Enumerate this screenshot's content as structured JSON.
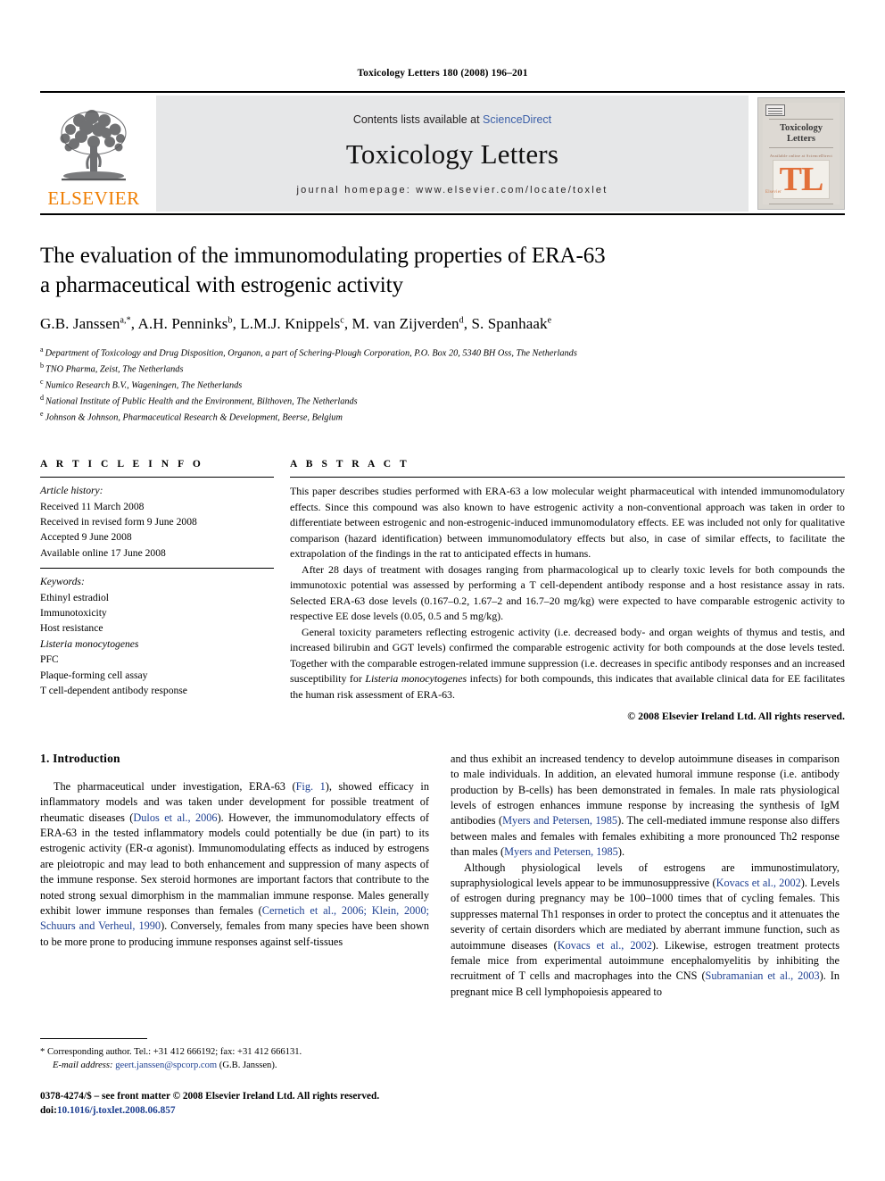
{
  "running_head": "Toxicology Letters 180 (2008) 196–201",
  "masthead": {
    "publisher": "ELSEVIER",
    "contents_prefix": "Contents lists available at ",
    "sciencedirect": "ScienceDirect",
    "journal_title": "Toxicology Letters",
    "homepage": "journal homepage: www.elsevier.com/locate/toxlet",
    "cover": {
      "title_line1": "Toxicology",
      "title_line2": "Letters",
      "subtitle": "Available online at ScienceDirect",
      "logo": "TL",
      "badge": "Elsevier"
    }
  },
  "article": {
    "title_line1": "The evaluation of the immunomodulating properties of ERA-63",
    "title_line2": "a pharmaceutical with estrogenic activity",
    "authors": [
      {
        "name": "G.B. Janssen",
        "sup": "a,*"
      },
      {
        "name": "A.H. Penninks",
        "sup": "b"
      },
      {
        "name": "L.M.J. Knippels",
        "sup": "c"
      },
      {
        "name": "M. van Zijverden",
        "sup": "d"
      },
      {
        "name": "S. Spanhaak",
        "sup": "e"
      }
    ],
    "affiliations": [
      {
        "mark": "a",
        "text": "Department of Toxicology and Drug Disposition, Organon, a part of Schering-Plough Corporation, P.O. Box 20, 5340 BH Oss, The Netherlands"
      },
      {
        "mark": "b",
        "text": "TNO Pharma, Zeist, The Netherlands"
      },
      {
        "mark": "c",
        "text": "Numico Research B.V., Wageningen, The Netherlands"
      },
      {
        "mark": "d",
        "text": "National Institute of Public Health and the Environment, Bilthoven, The Netherlands"
      },
      {
        "mark": "e",
        "text": "Johnson & Johnson, Pharmaceutical Research & Development, Beerse, Belgium"
      }
    ]
  },
  "article_info": {
    "heading": "A R T I C L E   I N F O",
    "history_label": "Article history:",
    "history": [
      "Received 11 March 2008",
      "Received in revised form 9 June 2008",
      "Accepted 9 June 2008",
      "Available online 17 June 2008"
    ],
    "keywords_label": "Keywords:",
    "keywords": [
      {
        "text": "Ethinyl estradiol",
        "italic": false
      },
      {
        "text": "Immunotoxicity",
        "italic": false
      },
      {
        "text": "Host resistance",
        "italic": false
      },
      {
        "text": "Listeria monocytogenes",
        "italic": true
      },
      {
        "text": "PFC",
        "italic": false
      },
      {
        "text": "Plaque-forming cell assay",
        "italic": false
      },
      {
        "text": "T cell-dependent antibody response",
        "italic": false
      }
    ]
  },
  "abstract": {
    "heading": "A B S T R A C T",
    "p1": "This paper describes studies performed with ERA-63 a low molecular weight pharmaceutical with intended immunomodulatory effects. Since this compound was also known to have estrogenic activity a non-conventional approach was taken in order to differentiate between estrogenic and non-estrogenic-induced immunomodulatory effects. EE was included not only for qualitative comparison (hazard identification) between immunomodulatory effects but also, in case of similar effects, to facilitate the extrapolation of the findings in the rat to anticipated effects in humans.",
    "p2": "After 28 days of treatment with dosages ranging from pharmacological up to clearly toxic levels for both compounds the immunotoxic potential was assessed by performing a T cell-dependent antibody response and a host resistance assay in rats. Selected ERA-63 dose levels (0.167–0.2, 1.67–2 and 16.7–20 mg/kg) were expected to have comparable estrogenic activity to respective EE dose levels (0.05, 0.5 and 5 mg/kg).",
    "p3_a": "General toxicity parameters reflecting estrogenic activity (i.e. decreased body- and organ weights of thymus and testis, and increased bilirubin and GGT levels) confirmed the comparable estrogenic activity for both compounds at the dose levels tested. Together with the comparable estrogen-related immune suppression (i.e. decreases in specific antibody responses and an increased susceptibility for ",
    "p3_italic": "Listeria monocytogenes",
    "p3_b": " infects) for both compounds, this indicates that available clinical data for EE facilitates the human risk assessment of ERA-63.",
    "copyright": "© 2008 Elsevier Ireland Ltd. All rights reserved."
  },
  "introduction": {
    "heading": "1.  Introduction",
    "left": {
      "p1_a": "The pharmaceutical under investigation, ERA-63 (",
      "p1_fig": "Fig. 1",
      "p1_b": "), showed efficacy in inflammatory models and was taken under development for possible treatment of rheumatic diseases (",
      "p1_ref1": "Dulos et al., 2006",
      "p1_c": "). However, the immunomodulatory effects of ERA-63 in the tested inflammatory models could potentially be due (in part) to its estrogenic activity (ER-α agonist). Immunomodulating effects as induced by estrogens are pleiotropic and may lead to both enhancement and suppression of many aspects of the immune response. Sex steroid hormones are important factors that contribute to the noted strong sexual dimorphism in the mammalian immune response. Males generally exhibit lower immune responses than females (",
      "p1_ref2": "Cernetich et al., 2006; Klein, 2000; Schuurs and Verheul, 1990",
      "p1_d": "). Conversely, females from many species have been shown to be more prone to producing immune responses against self-tissues"
    },
    "right": {
      "p1_cont_a": "and thus exhibit an increased tendency to develop autoimmune diseases in comparison to male individuals. In addition, an elevated humoral immune response (i.e. antibody production by B-cells) has been demonstrated in females. In male rats physiological levels of estrogen enhances immune response by increasing the synthesis of IgM antibodies (",
      "p1_ref3": "Myers and Petersen, 1985",
      "p1_cont_b": "). The cell-mediated immune response also differs between males and females with females exhibiting a more pronounced Th2 response than males (",
      "p1_ref4": "Myers and Petersen, 1985",
      "p1_cont_c": ").",
      "p2_a": "Although physiological levels of estrogens are immunostimulatory, supraphysiological levels appear to be immunosuppressive (",
      "p2_ref1": "Kovacs et al., 2002",
      "p2_b": "). Levels of estrogen during pregnancy may be 100–1000 times that of cycling females. This suppresses maternal Th1 responses in order to protect the conceptus and it attenuates the severity of certain disorders which are mediated by aberrant immune function, such as autoimmune diseases (",
      "p2_ref2": "Kovacs et al., 2002",
      "p2_c": "). Likewise, estrogen treatment protects female mice from experimental autoimmune encephalomyelitis by inhibiting the recruitment of T cells and macrophages into the CNS (",
      "p2_ref3": "Subramanian et al., 2003",
      "p2_d": "). In pregnant mice B cell lymphopoiesis appeared to"
    }
  },
  "footnotes": {
    "corresponding_mark": "*",
    "corresponding": "Corresponding author. Tel.: +31 412 666192; fax: +31 412 666131.",
    "email_label": "E-mail address:",
    "email": "geert.janssen@spcorp.com",
    "email_owner": "(G.B. Janssen)."
  },
  "imprint": {
    "issn_line": "0378-4274/$ – see front matter © 2008 Elsevier Ireland Ltd. All rights reserved.",
    "doi_label": "doi:",
    "doi": "10.1016/j.toxlet.2008.06.857"
  },
  "colors": {
    "elsevier_orange": "#ef7d00",
    "link_blue": "#1d3f91",
    "sciencedirect_blue": "#3b5fa8",
    "banner_gray": "#e6e7e8"
  }
}
